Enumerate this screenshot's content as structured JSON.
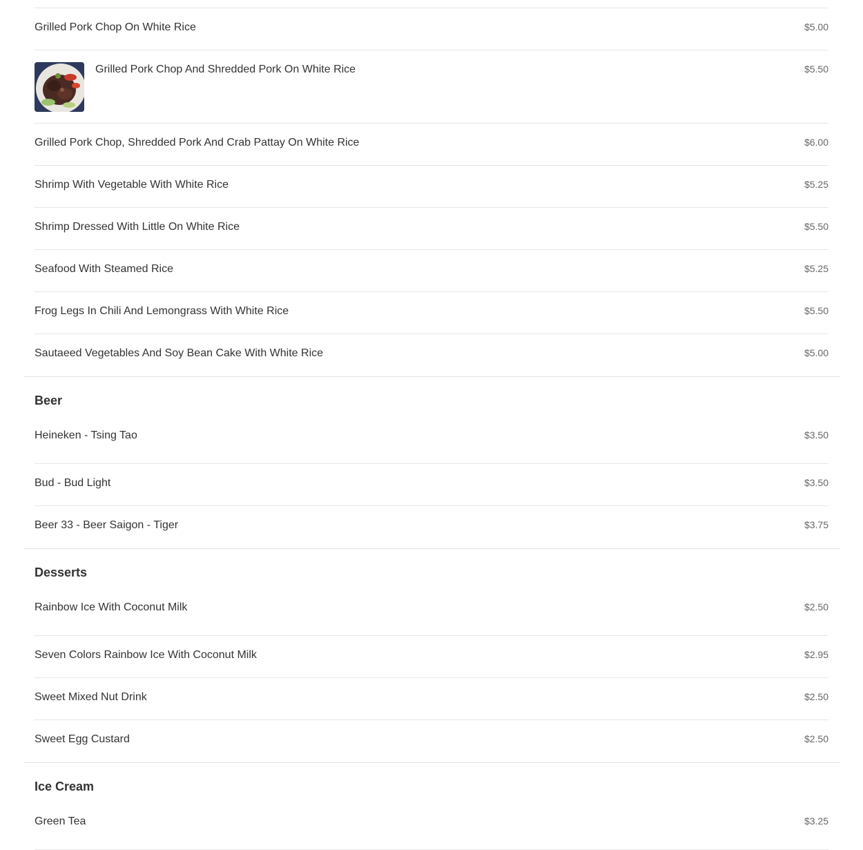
{
  "sections": [
    {
      "title": "",
      "items": [
        {
          "name": "Grilled Pork Chop On White Rice",
          "price": "$5.00"
        },
        {
          "name": "Grilled Pork Chop And Shredded Pork On White Rice",
          "price": "$5.50",
          "photo": true
        },
        {
          "name": "Grilled Pork Chop, Shredded Pork And Crab Pattay On White Rice",
          "price": "$6.00"
        },
        {
          "name": "Shrimp With Vegetable With White Rice",
          "price": "$5.25"
        },
        {
          "name": "Shrimp Dressed With Little On White Rice",
          "price": "$5.50"
        },
        {
          "name": "Seafood With Steamed Rice",
          "price": "$5.25"
        },
        {
          "name": "Frog Legs In Chili And Lemongrass With White Rice",
          "price": "$5.50"
        },
        {
          "name": "Sautaeed Vegetables And Soy Bean Cake With White Rice",
          "price": "$5.00"
        }
      ]
    },
    {
      "title": "Beer",
      "items": [
        {
          "name": "Heineken - Tsing Tao",
          "price": "$3.50"
        },
        {
          "name": "Bud - Bud Light",
          "price": "$3.50"
        },
        {
          "name": "Beer 33 - Beer Saigon - Tiger",
          "price": "$3.75"
        }
      ]
    },
    {
      "title": "Desserts",
      "items": [
        {
          "name": "Rainbow Ice With Coconut Milk",
          "price": "$2.50"
        },
        {
          "name": "Seven Colors Rainbow Ice With Coconut Milk",
          "price": "$2.95"
        },
        {
          "name": "Sweet Mixed Nut Drink",
          "price": "$2.50"
        },
        {
          "name": "Sweet Egg Custard",
          "price": "$2.50"
        }
      ]
    },
    {
      "title": "Ice Cream",
      "items": [
        {
          "name": "Green Tea",
          "price": "$3.25"
        }
      ]
    }
  ]
}
